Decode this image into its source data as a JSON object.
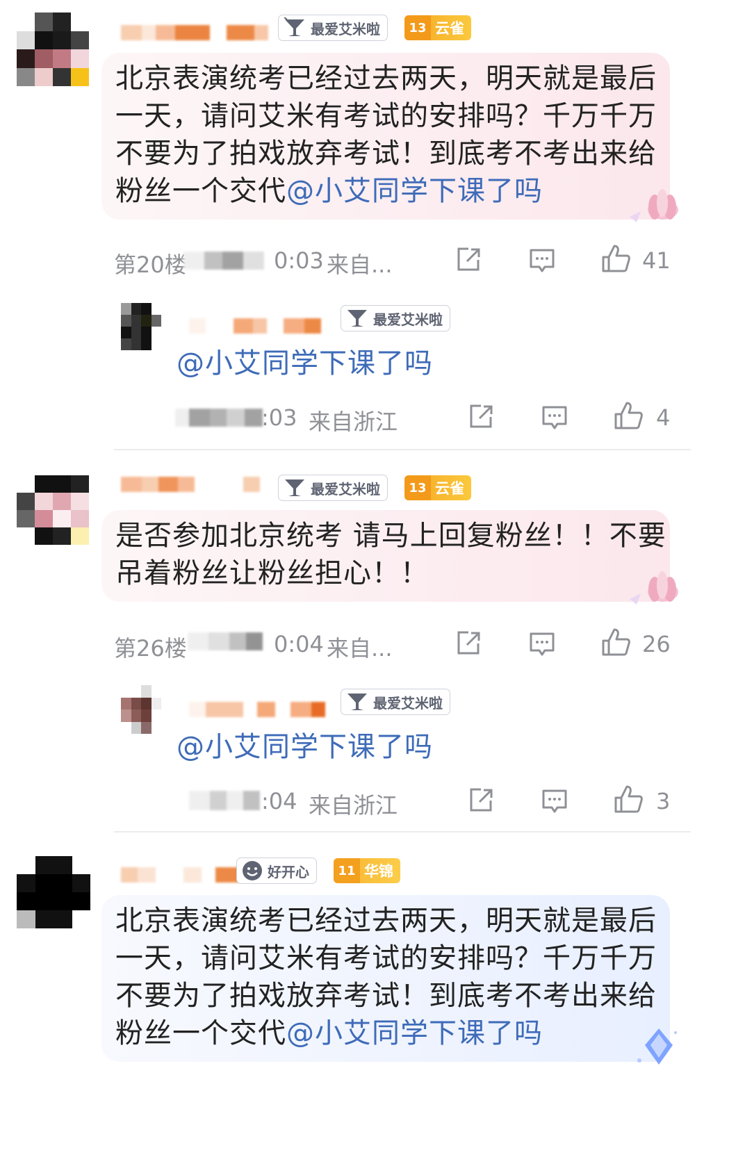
{
  "comments": [
    {
      "fan_badge": "最爱艾米啦",
      "level": {
        "number": "13",
        "name": "云雀"
      },
      "text": "北京表演统考已经过去两天，明天就是最后一天，请问艾米有考试的安排吗？千万千万不要为了拍戏放弃考试！到底考不考出来给粉丝一个交代",
      "mention": "@小艾同学下课了吗",
      "floor": "第20楼",
      "time": "0:03",
      "location": "来自...",
      "likes": "41",
      "reply": {
        "fan_badge": "最爱艾米啦",
        "text": "@小艾同学下课了吗",
        "time": ":03",
        "location": "来自浙江",
        "likes": "4"
      }
    },
    {
      "fan_badge": "最爱艾米啦",
      "level": {
        "number": "13",
        "name": "云雀"
      },
      "text": "是否参加北京统考 请马上回复粉丝！！不要吊着粉丝让粉丝担心！！",
      "mention": "",
      "floor": "第26楼",
      "time": "0:04",
      "location": "来自...",
      "likes": "26",
      "reply": {
        "fan_badge": "最爱艾米啦",
        "text": "@小艾同学下课了吗",
        "time": ":04",
        "location": "来自浙江",
        "likes": "3"
      }
    },
    {
      "fan_badge": "好开心",
      "level": {
        "number": "11",
        "name": "华锦"
      },
      "text": "北京表演统考已经过去两天，明天就是最后一天，请问艾米有考试的安排吗？千万千万不要为了拍戏放弃考试！到底考不考出来给粉丝一个交代",
      "mention": "@小艾同学下课了吗"
    }
  ],
  "colors": {
    "mention": "#3e6bb8",
    "meta": "#8f9096",
    "level_gold": "#f7b733",
    "bubble_pink": "#fbe7ec",
    "bubble_blue": "#e8efff"
  }
}
